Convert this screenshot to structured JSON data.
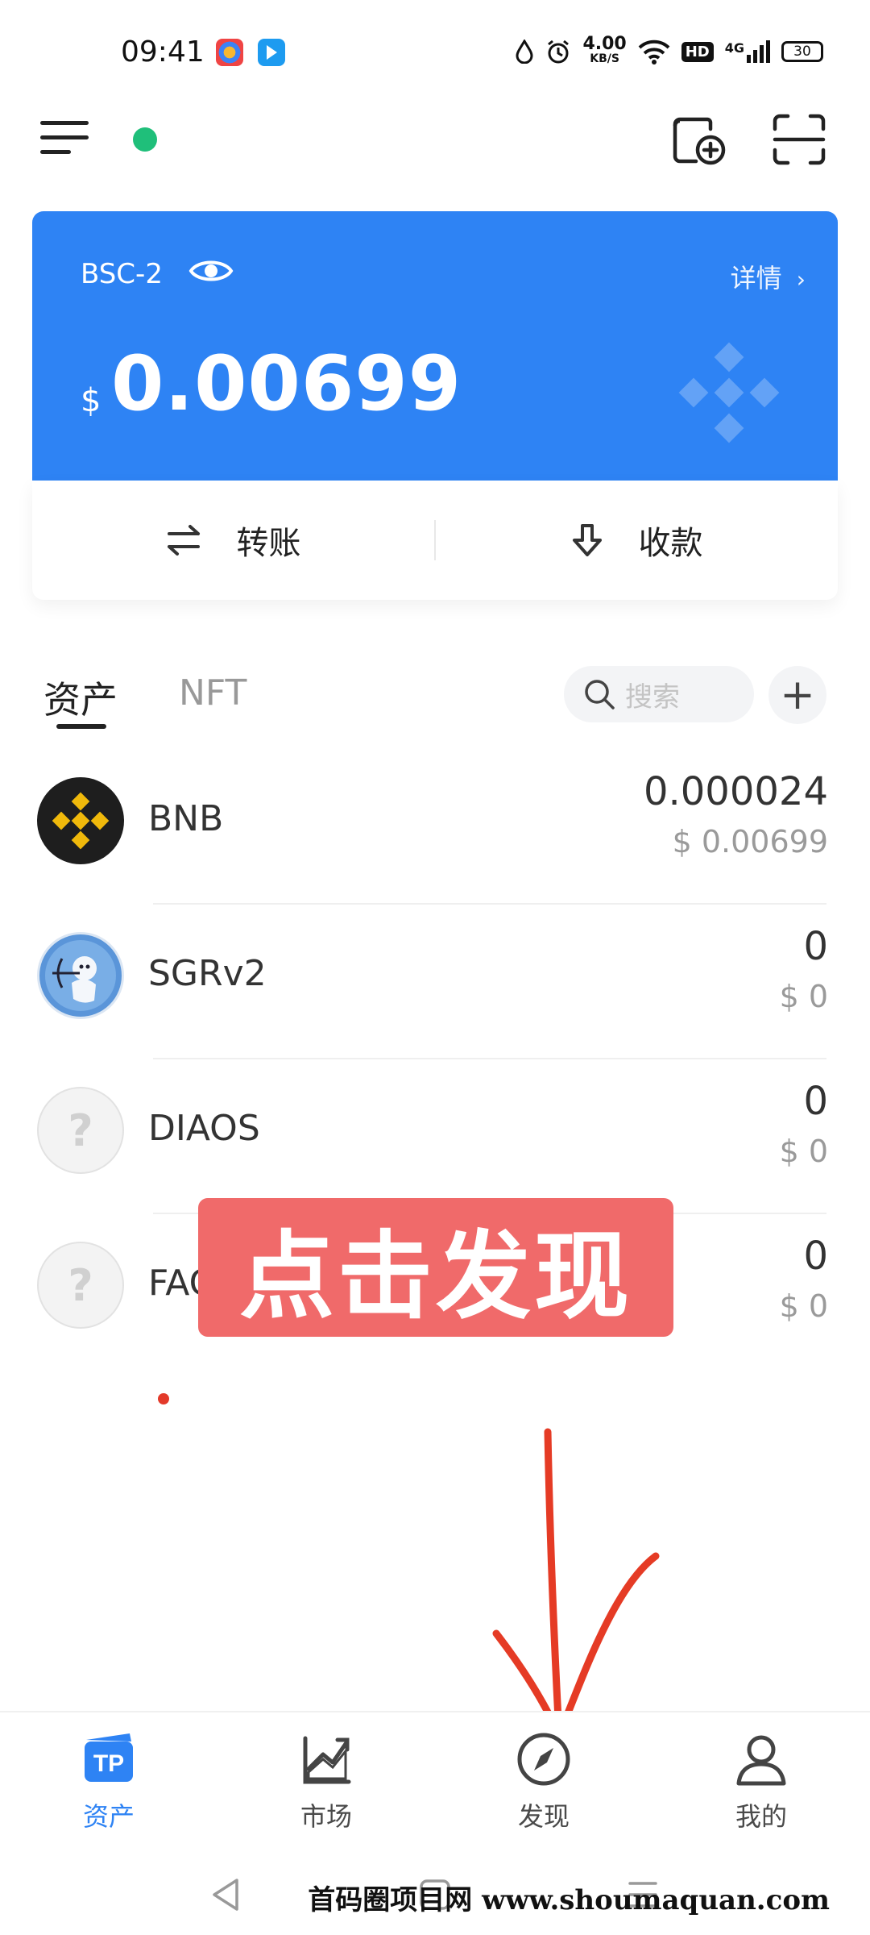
{
  "status_bar": {
    "time": "09:41",
    "network_speed_value": "4.00",
    "network_speed_unit": "KB/S",
    "hd": "HD",
    "cell": "4G",
    "battery": "30"
  },
  "card": {
    "network": "BSC-2",
    "details_label": "详情",
    "currency_symbol": "$",
    "balance": "0.00699",
    "accent_color": "#2e83f4"
  },
  "actions": {
    "transfer_label": "转账",
    "receive_label": "收款"
  },
  "tabs": {
    "assets": "资产",
    "nft": "NFT"
  },
  "search": {
    "placeholder": "搜索"
  },
  "tokens": [
    {
      "name": "BNB",
      "amount": "0.000024",
      "value": "$ 0.00699",
      "icon": "bnb-logo"
    },
    {
      "name": "SGRv2",
      "amount": "0",
      "value": "$ 0",
      "icon": "sgr-logo"
    },
    {
      "name": "DIAOS",
      "amount": "0",
      "value": "$ 0",
      "icon": "unknown-token-icon"
    },
    {
      "name": "FAC",
      "amount": "0",
      "value": "$ 0",
      "icon": "unknown-token-icon"
    }
  ],
  "overlay": {
    "banner_text": "点击发现"
  },
  "bottom_nav": [
    {
      "label": "资产",
      "icon": "tp-wallet-icon",
      "active": true
    },
    {
      "label": "市场",
      "icon": "market-chart-icon",
      "active": false
    },
    {
      "label": "发现",
      "icon": "compass-icon",
      "active": false
    },
    {
      "label": "我的",
      "icon": "profile-icon",
      "active": false
    }
  ],
  "watermark": "首码圈项目网 www.shoumaquan.com"
}
